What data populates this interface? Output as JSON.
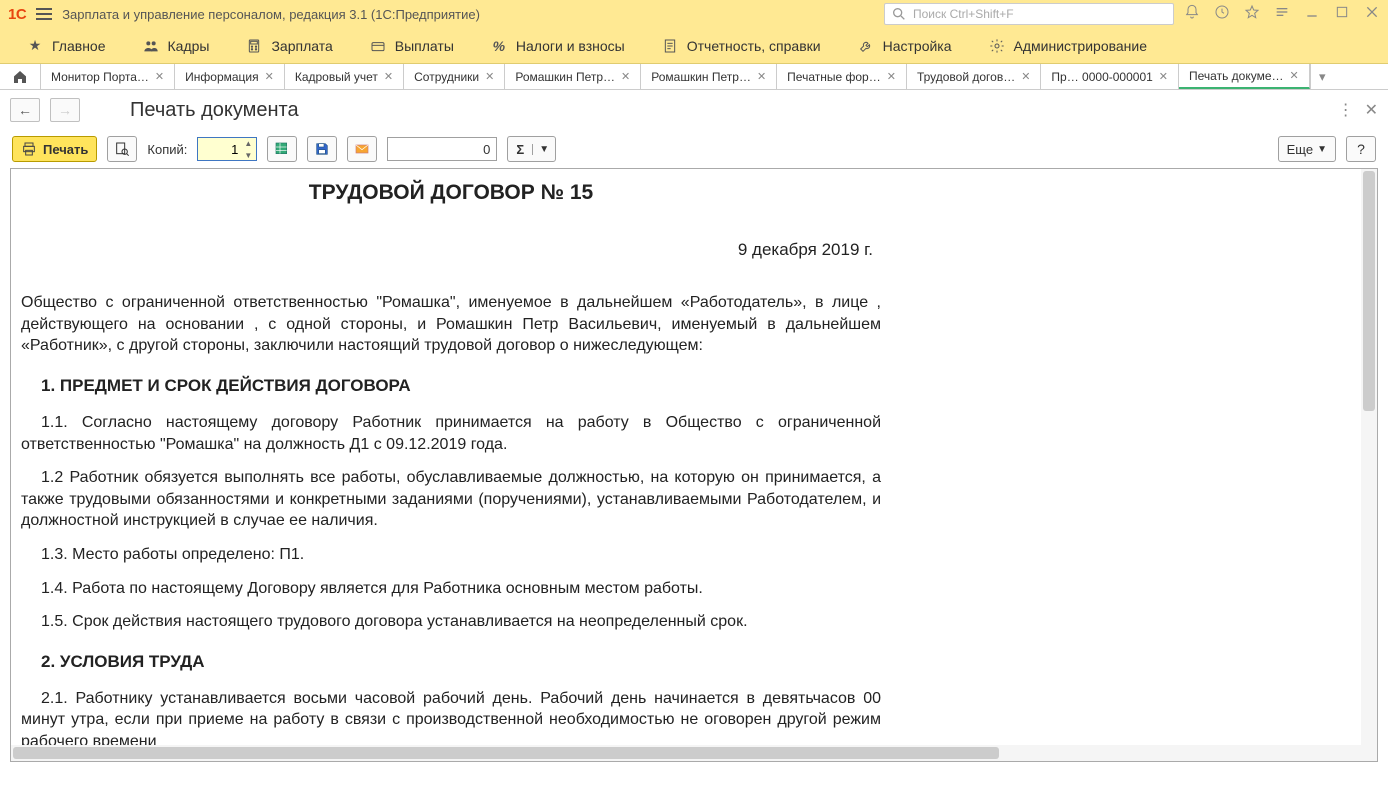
{
  "window": {
    "app_title": "Зарплата и управление персоналом, редакция 3.1  (1С:Предприятие)",
    "search_placeholder": "Поиск Ctrl+Shift+F"
  },
  "menu": [
    {
      "label": "Главное",
      "icon": "star"
    },
    {
      "label": "Кадры",
      "icon": "people"
    },
    {
      "label": "Зарплата",
      "icon": "calc"
    },
    {
      "label": "Выплаты",
      "icon": "wallet"
    },
    {
      "label": "Налоги и взносы",
      "icon": "percent"
    },
    {
      "label": "Отчетность, справки",
      "icon": "report"
    },
    {
      "label": "Настройка",
      "icon": "wrench"
    },
    {
      "label": "Администрирование",
      "icon": "gear"
    }
  ],
  "tabs": [
    {
      "label": "Монитор Порта…",
      "closable": true
    },
    {
      "label": "Информация",
      "closable": true
    },
    {
      "label": "Кадровый учет",
      "closable": true
    },
    {
      "label": "Сотрудники",
      "closable": true
    },
    {
      "label": "Ромашкин Петр…",
      "closable": true
    },
    {
      "label": "Ромашкин Петр…",
      "closable": true
    },
    {
      "label": "Печатные фор…",
      "closable": true
    },
    {
      "label": "Трудовой догов…",
      "closable": true
    },
    {
      "label": "Пр… 0000-000001",
      "closable": true
    },
    {
      "label": "Печать докуме…",
      "closable": true,
      "active": true
    }
  ],
  "page": {
    "title": "Печать документа"
  },
  "toolbar": {
    "print_label": "Печать",
    "copies_label": "Копий:",
    "copies_value": "1",
    "number_box": "0",
    "more_label": "Еще",
    "help_label": "?"
  },
  "document": {
    "title": "ТРУДОВОЙ ДОГОВОР № 15",
    "date": "9 декабря 2019 г.",
    "intro": "Общество с ограниченной ответственностью \"Ромашка\", именуемое в дальнейшем «Работодатель», в лице  , действующего на основании , с одной стороны, и Ромашкин Петр Васильевич, именуемый в дальнейшем «Работник», с другой стороны, заключили настоящий трудовой договор о нижеследующем:",
    "section1_title": "1. ПРЕДМЕТ И СРОК ДЕЙСТВИЯ ДОГОВОРА",
    "c1_1": "1.1. Согласно настоящему договору Работник принимается на работу в Общество с ограниченной ответственностью \"Ромашка\" на должность Д1 с 09.12.2019 года.",
    "c1_2": "1.2 Работник обязуется выполнять все работы, обуславливаемые должностью, на которую он принимается, а также трудовыми обязанностями и конкретными заданиями (поручениями), устанавливаемыми Работодателем, и должностной инструкцией в случае ее наличия.",
    "c1_3": "1.3. Место работы определено: П1.",
    "c1_4": "1.4. Работа по настоящему Договору является для Работника основным местом работы.",
    "c1_5": "1.5. Срок действия настоящего трудового договора устанавливается на неопределенный срок.",
    "section2_title": "2. УСЛОВИЯ ТРУДА",
    "c2_1": "2.1. Работнику устанавливается восьми часовой рабочий день. Рабочий день начинается в девятьчасов 00 минут утра, если при приеме на работу в связи с производственной необходимостью не оговорен другой режим рабочего времени"
  }
}
